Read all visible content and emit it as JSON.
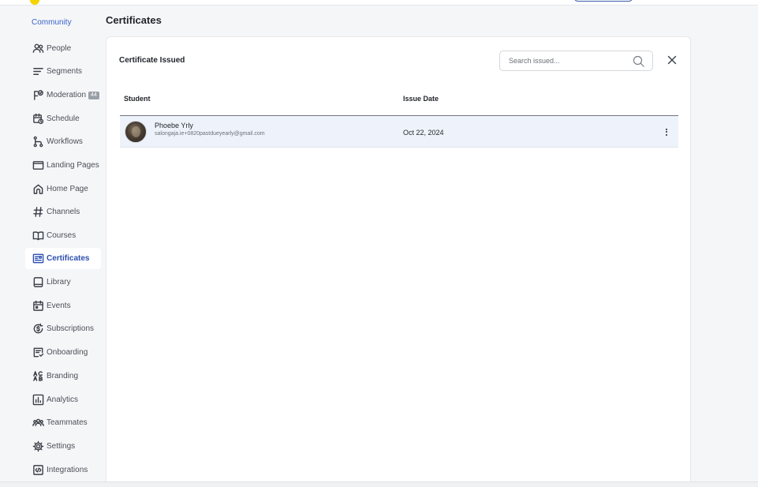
{
  "sidebar": {
    "community_label": "Community",
    "items": [
      {
        "label": "People",
        "icon": "people-icon"
      },
      {
        "label": "Segments",
        "icon": "segments-icon"
      },
      {
        "label": "Moderation",
        "icon": "moderation-icon",
        "badge": "44"
      },
      {
        "label": "Schedule",
        "icon": "schedule-icon"
      },
      {
        "label": "Workflows",
        "icon": "workflows-icon"
      },
      {
        "label": "Landing Pages",
        "icon": "landing-pages-icon"
      },
      {
        "label": "Home Page",
        "icon": "home-icon"
      },
      {
        "label": "Channels",
        "icon": "hash-icon"
      },
      {
        "label": "Courses",
        "icon": "book-icon"
      },
      {
        "label": "Certificates",
        "icon": "certificate-icon",
        "active": true
      },
      {
        "label": "Library",
        "icon": "library-icon"
      },
      {
        "label": "Events",
        "icon": "calendar-icon"
      },
      {
        "label": "Subscriptions",
        "icon": "subscriptions-icon"
      },
      {
        "label": "Onboarding",
        "icon": "onboarding-icon"
      },
      {
        "label": "Branding",
        "icon": "branding-icon"
      },
      {
        "label": "Analytics",
        "icon": "analytics-icon"
      },
      {
        "label": "Teammates",
        "icon": "teammates-icon"
      },
      {
        "label": "Settings",
        "icon": "gear-icon"
      },
      {
        "label": "Integrations",
        "icon": "integrations-icon"
      }
    ]
  },
  "page": {
    "title": "Certificates"
  },
  "panel": {
    "title": "Certificate Issued",
    "search_placeholder": "Search issued...",
    "columns": {
      "student": "Student",
      "issue_date": "Issue Date"
    },
    "rows": [
      {
        "name": "Phoebe Yrly",
        "email": "salongaja.ie+0820pastdueyearly@gmail.com",
        "issue_date": "Oct 22, 2024"
      }
    ]
  },
  "colors": {
    "accent": "#2c4fb0",
    "community_link": "#3a62c9",
    "row_highlight": "#eef3fb",
    "logo": "#f5d300"
  }
}
